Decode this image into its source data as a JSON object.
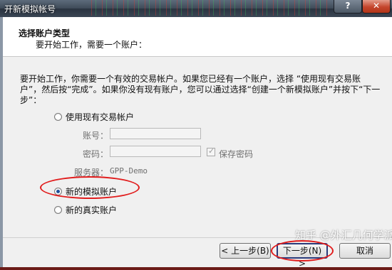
{
  "window": {
    "title": "开新模拟帐号",
    "help_label": "?",
    "close_label": "✕"
  },
  "header": {
    "title": "选择账户类型",
    "subtitle": "要开始工作，需要一个账户："
  },
  "description": "要开始工作，你需要一个有效的交易帐户。如果您已经有一个账户，选择 “使用现有交易账户”，然后按“完成”。如果你没有现有账户，您可以通过选择“创建一个新模拟账户”并按下“下一步”：",
  "options": {
    "existing_label": "使用现有交易帐户",
    "account_label": "账号：",
    "account_value": "",
    "password_label": "密码：",
    "password_value": "",
    "save_password_label": "保存密码",
    "save_password_checked": true,
    "server_label": "服务器：",
    "server_value": "GPP-Demo",
    "new_demo_label": "新的模拟账户",
    "new_real_label": "新的真实账户",
    "selected": "new_demo"
  },
  "buttons": {
    "back_label": "< 上一步(B)",
    "next_label": "下一步(N) >",
    "cancel_label": "取消"
  },
  "watermark": "知乎 @外汇几何学派",
  "colors": {
    "highlight": "#e11c1c",
    "title_bar": "#3e4a58"
  }
}
